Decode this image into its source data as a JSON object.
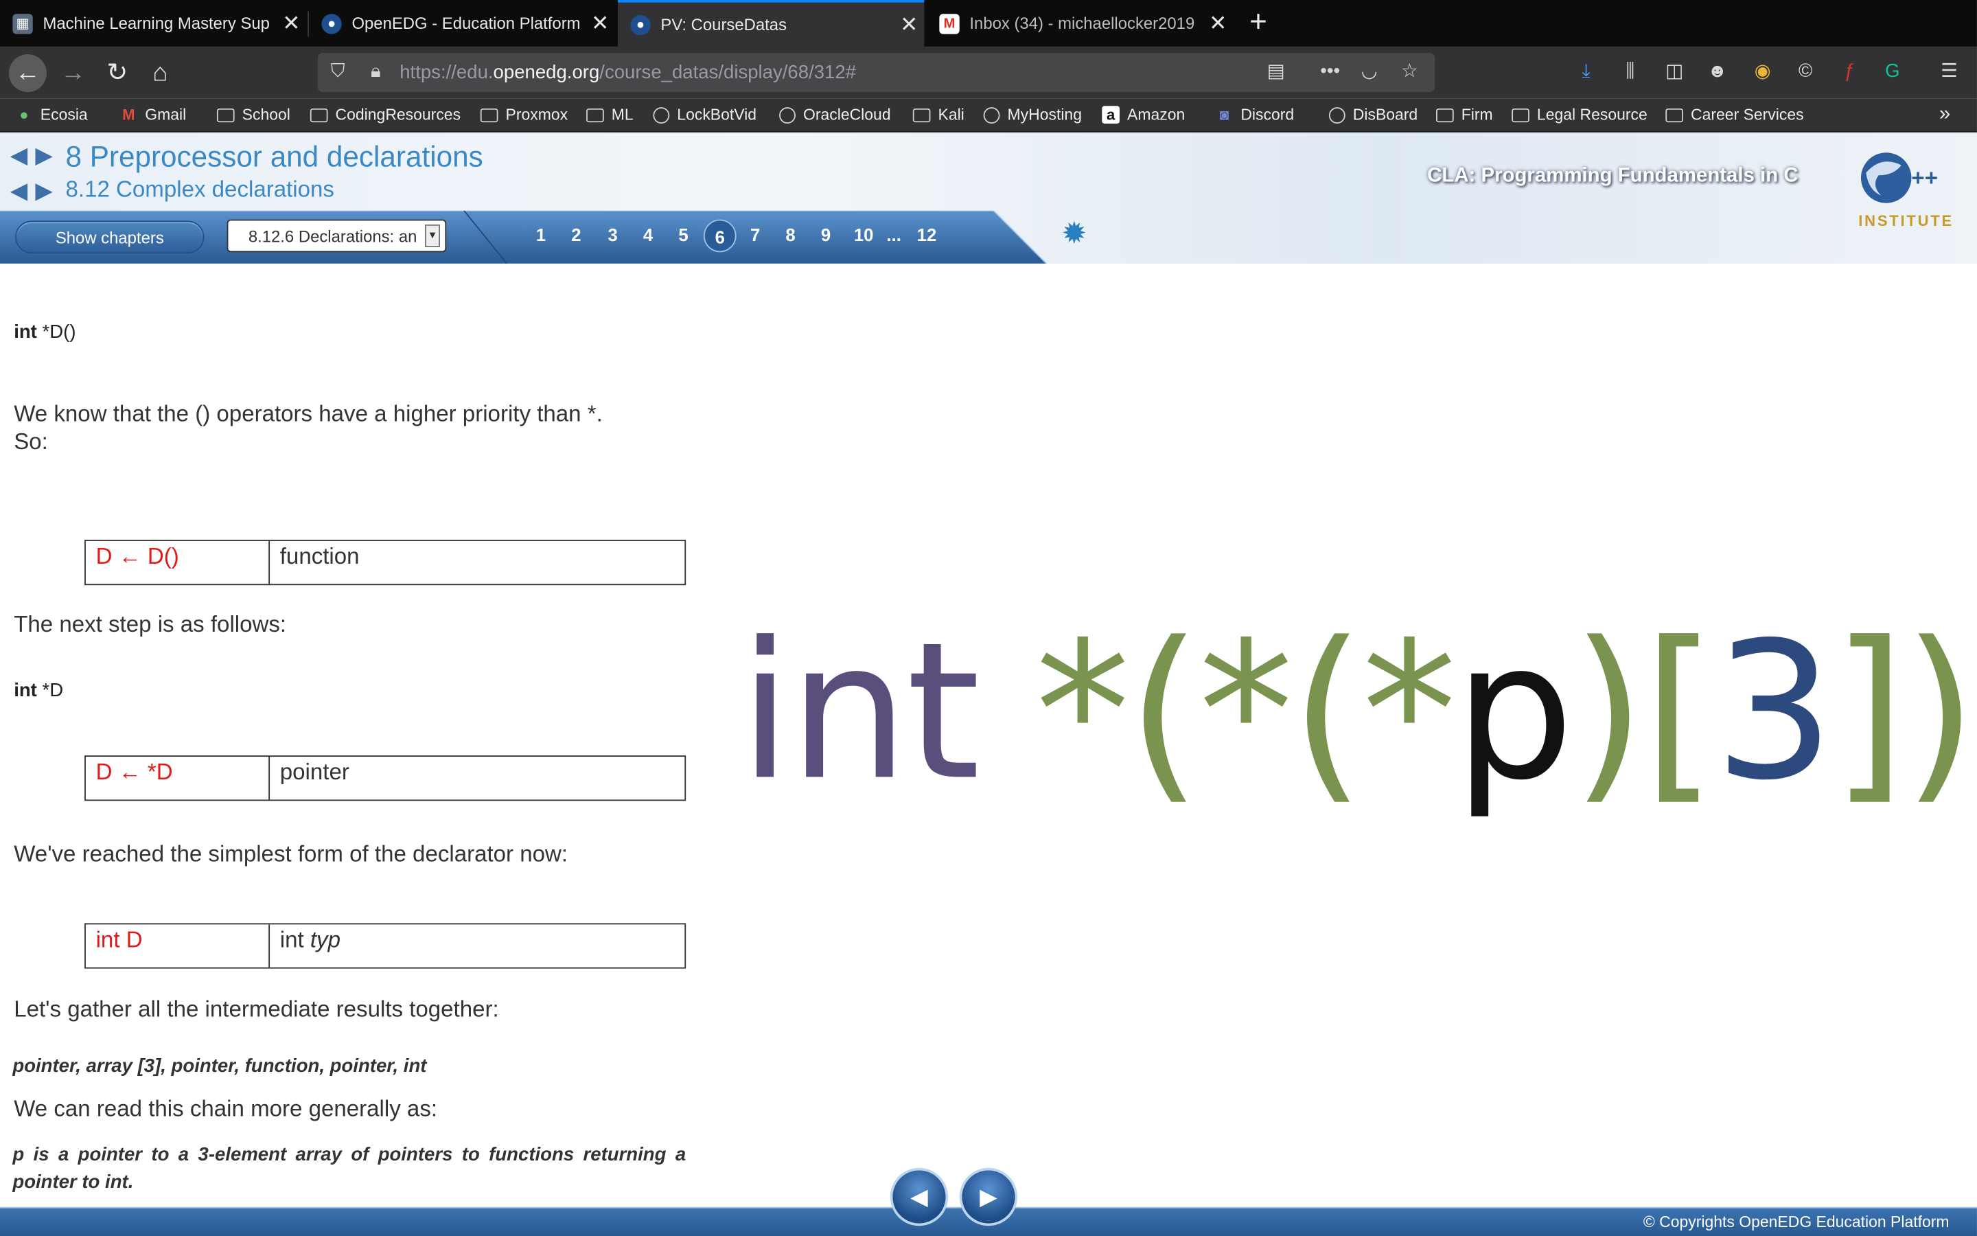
{
  "browser": {
    "tabs": [
      {
        "title": "Machine Learning Mastery Sup",
        "active": false
      },
      {
        "title": "OpenEDG - Education Platform",
        "active": false
      },
      {
        "title": "PV: CourseDatas",
        "active": true
      },
      {
        "title": "Inbox (34) - michaellocker2019",
        "active": false
      }
    ],
    "url_prefix": "https://edu.",
    "url_domain": "openedg.org",
    "url_path": "/course_datas/display/68/312#",
    "bookmarks": [
      {
        "label": "Ecosia",
        "icon": "ecosia-icon"
      },
      {
        "label": "Gmail",
        "icon": "gmail-icon"
      },
      {
        "label": "School",
        "icon": "folder-icon"
      },
      {
        "label": "CodingResources",
        "icon": "folder-icon"
      },
      {
        "label": "Proxmox",
        "icon": "folder-icon"
      },
      {
        "label": "ML",
        "icon": "folder-icon"
      },
      {
        "label": "LockBotVid",
        "icon": "globe-icon"
      },
      {
        "label": "OracleCloud",
        "icon": "globe-icon"
      },
      {
        "label": "Kali",
        "icon": "folder-icon"
      },
      {
        "label": "MyHosting",
        "icon": "globe-icon"
      },
      {
        "label": "Amazon",
        "icon": "amazon-icon"
      },
      {
        "label": "Discord",
        "icon": "discord-icon"
      },
      {
        "label": "DisBoard",
        "icon": "globe-icon"
      },
      {
        "label": "Firm",
        "icon": "folder-icon"
      },
      {
        "label": "Legal Resource",
        "icon": "folder-icon"
      },
      {
        "label": "Career Services",
        "icon": "folder-icon"
      }
    ]
  },
  "course": {
    "chapter_title": "8 Preprocessor and declarations",
    "section_title": "8.12 Complex declarations",
    "course_name": "CLA: Programming Fundamentals in C",
    "logo_text": "C++",
    "institute_label": "INSTITUTE",
    "show_chapters_label": "Show chapters",
    "section_select_value": "8.12.6 Declarations: an",
    "pages": [
      "1",
      "2",
      "3",
      "4",
      "5",
      "6",
      "7",
      "8",
      "9",
      "10",
      "...",
      "12"
    ],
    "current_page": "6"
  },
  "content": {
    "code1_kw": "int",
    "code1_rest": " *D()",
    "para1_line1": "We know that the () operators have a higher priority than *.",
    "para1_line2": "So:",
    "table1": {
      "left": "D ← D()",
      "right": "function"
    },
    "para2": "The next step is as follows:",
    "code2_kw": "int",
    "code2_rest": " *D",
    "table2": {
      "left": "D ← *D",
      "right": "pointer"
    },
    "para3": "We've reached the simplest form of the declarator now:",
    "table3": {
      "left": "int D",
      "right_plain": "int ",
      "right_italic": "typ"
    },
    "para4": "Let's gather all the intermediate results together:",
    "chain_results": "pointer, array [3], pointer, function, pointer, int",
    "para5": "We can read this chain more generally as:",
    "chain_text": "p is a pointer to a 3-element array of pointers to functions returning a pointer to int."
  },
  "declaration": {
    "parts": [
      {
        "text": "int",
        "color": "#5a4e7c"
      },
      {
        "text": " *(*(*",
        "color": "#7a9450"
      },
      {
        "text": "p",
        "color": "#111111"
      },
      {
        "text": ")[",
        "color": "#7a9450"
      },
      {
        "text": "3",
        "color": "#2d4a7e"
      },
      {
        "text": "])();",
        "color": "#7a9450"
      }
    ]
  },
  "footer": {
    "copyright": "© Copyrights OpenEDG Education Platform",
    "prev_label": "◀",
    "next_label": "▶"
  },
  "colors": {
    "link_blue": "#3b89c4",
    "highlight_red": "#e01b1b",
    "toolbar_blue": "#2e5f99"
  }
}
